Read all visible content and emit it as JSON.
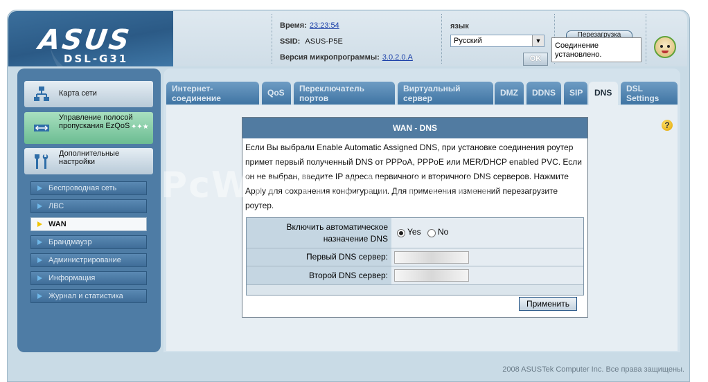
{
  "header": {
    "brand": "ASUS",
    "model": "DSL-G31",
    "time_label": "Время:",
    "time_value": "23:23:54",
    "ssid_label": "SSID:",
    "ssid_value": "ASUS-P5E",
    "firmware_label": "Версия микропрограммы:",
    "firmware_value": "3.0.2.0.A",
    "lang_label": "язык",
    "lang_selected": "Русский",
    "ok_label": "OK",
    "top_button_label": "Перезагрузка",
    "status_tooltip": "Соединение установлено."
  },
  "sidebar": {
    "major": [
      {
        "label": "Карта сети",
        "icon": "network-map-icon"
      },
      {
        "label": "Управление полосой пропускания EzQoS",
        "icon": "bandwidth-icon"
      },
      {
        "label": "Дополнительные настройки",
        "icon": "tools-icon"
      }
    ],
    "items": [
      {
        "label": "Беспроводная сеть"
      },
      {
        "label": "ЛВС"
      },
      {
        "label": "WAN"
      },
      {
        "label": "Брандмауэр"
      },
      {
        "label": "Администрирование"
      },
      {
        "label": "Информация"
      },
      {
        "label": "Журнал и статистика"
      }
    ]
  },
  "tabs": [
    {
      "label": "Интернет-соединение",
      "active": false
    },
    {
      "label": "QoS",
      "active": false
    },
    {
      "label": "Переключатель портов",
      "active": false
    },
    {
      "label": "Виртуальный сервер",
      "active": false
    },
    {
      "label": "DMZ",
      "active": false
    },
    {
      "label": "DDNS",
      "active": false
    },
    {
      "label": "SIP",
      "active": false
    },
    {
      "label": "DNS",
      "active": true
    },
    {
      "label": "DSL Settings",
      "active": false
    }
  ],
  "watermark": "PcWinTech.com",
  "dialog": {
    "title": "WAN - DNS",
    "description": "Если Вы выбрали Enable Automatic Assigned DNS, при установке соединения роутер примет первый полученный DNS от PPPoA, PPPoE или MER/DHCP enabled PVC. Если он не выбран, введите IP адреса первичного и вторичного DNS серверов. Нажмите Apply для сохранения конфигурации. Для применения изменений перезагрузите роутер.",
    "auto_dns_label": "Включить автоматическое назначение DNS",
    "yes_label": "Yes",
    "no_label": "No",
    "auto_dns_selected": "Yes",
    "primary_dns_label": "Первый DNS сервер:",
    "secondary_dns_label": "Второй DNS сервер:",
    "apply_label": "Применить"
  },
  "footer": "2008 ASUSTek Computer Inc. Все права защищены."
}
